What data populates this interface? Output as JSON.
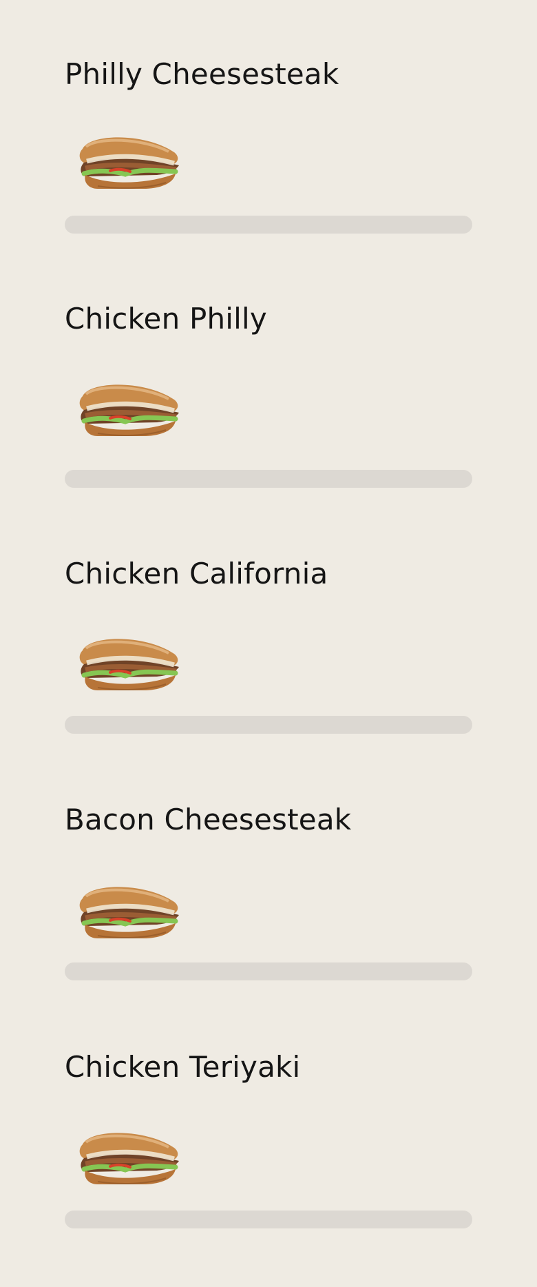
{
  "menu": {
    "items": [
      {
        "name": "Philly Cheesesteak",
        "image": "sandwich-image"
      },
      {
        "name": "Chicken Philly",
        "image": "sandwich-image"
      },
      {
        "name": "Chicken California",
        "image": "sandwich-image"
      },
      {
        "name": "Bacon Cheesesteak",
        "image": "sandwich-image"
      },
      {
        "name": "Chicken Teriyaki",
        "image": "sandwich-image"
      }
    ]
  }
}
